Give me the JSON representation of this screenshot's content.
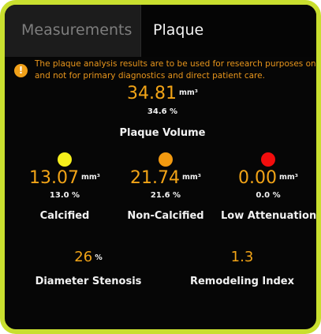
{
  "tabs": [
    {
      "label": "Measurements",
      "active": false
    },
    {
      "label": "Plaque",
      "active": true
    }
  ],
  "warning": {
    "icon": "!",
    "line1": "The plaque analysis results are to be used for research purposes only,",
    "line2": "and not for primary diagnostics and direct patient care."
  },
  "plaque_volume": {
    "value": "34.81",
    "unit": "mm³",
    "percent": "34.6 %",
    "label": "Plaque Volume"
  },
  "categories": [
    {
      "value": "13.07",
      "unit": "mm³",
      "percent": "13.0 %",
      "label": "Calcified",
      "color": "#f6ef1c"
    },
    {
      "value": "21.74",
      "unit": "mm³",
      "percent": "21.6 %",
      "label": "Non-Calcified",
      "color": "#f39a10"
    },
    {
      "value": "0.00",
      "unit": "mm³",
      "percent": "0.0 %",
      "label": "Low Attenuation",
      "color": "#f20d0d"
    }
  ],
  "stenosis": {
    "value": "26",
    "unit": "%",
    "label": "Diameter Stenosis"
  },
  "remodeling": {
    "value": "1.3",
    "label": "Remodeling Index"
  },
  "colors": {
    "frame": "#c9df2f",
    "accent": "#f2a417",
    "warning": "#e9961c"
  }
}
